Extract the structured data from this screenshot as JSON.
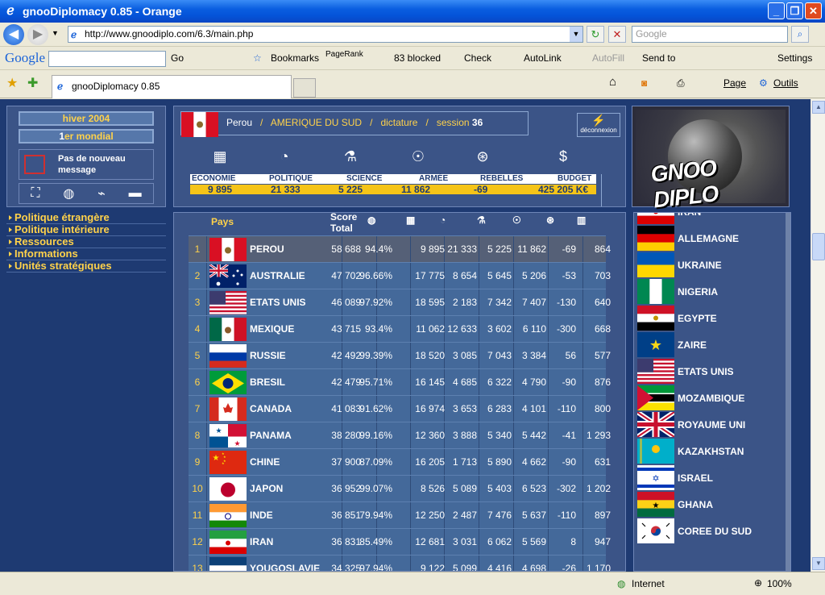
{
  "window": {
    "title": "gnooDiplomacy 0.85 - Orange"
  },
  "nav": {
    "url": "http://www.gnoodiplo.com/6.3/main.php",
    "search_placeholder": "Google"
  },
  "google_toolbar": {
    "logo": "Google",
    "go": "Go",
    "bookmarks": "Bookmarks",
    "pagerank": "PageRank",
    "blocked": "83 blocked",
    "check": "Check",
    "autolink": "AutoLink",
    "autofill": "AutoFill",
    "sendto": "Send to",
    "settings": "Settings"
  },
  "tabs": {
    "active": "gnooDiplomacy 0.85",
    "page": "Page",
    "outils": "Outils"
  },
  "left": {
    "season": "hiver 2004",
    "rank_num": "1",
    "rank_suffix": "er mondial",
    "message": "Pas de nouveau message"
  },
  "menu": [
    "Politique étrangère",
    "Politique intérieure",
    "Ressources",
    "Informations",
    "Unités stratégiques"
  ],
  "country": {
    "name": "Perou",
    "sep": "/",
    "continent": "AMERIQUE DU SUD",
    "regime": "dictature",
    "session_label": "session",
    "session": "36"
  },
  "deconnexion": "déconnexion",
  "stats": {
    "labels": [
      "ECONOMIE",
      "POLITIQUE",
      "SCIENCE",
      "ARMÉE",
      "REBELLES",
      "BUDGET"
    ],
    "values": [
      "9 895",
      "21 333",
      "5 225",
      "11 862",
      "-69",
      "425 205 K€"
    ]
  },
  "ranking": {
    "header": {
      "pays": "Pays",
      "score": "Score",
      "total": "Total"
    },
    "rows": [
      {
        "rank": "1",
        "flag": "peru",
        "name": "PEROU",
        "score": "58 688",
        "pct": "94.4%",
        "eco": "9 895",
        "pol": "21 333",
        "sci": "5 225",
        "arm": "11 862",
        "reb": "-69",
        "ind": "864"
      },
      {
        "rank": "2",
        "flag": "australia",
        "name": "AUSTRALIE",
        "score": "47 702",
        "pct": "96.66%",
        "eco": "17 775",
        "pol": "8 654",
        "sci": "5 645",
        "arm": "5 206",
        "reb": "-53",
        "ind": "703"
      },
      {
        "rank": "3",
        "flag": "usa",
        "name": "ETATS UNIS",
        "score": "46 089",
        "pct": "97.92%",
        "eco": "18 595",
        "pol": "2 183",
        "sci": "7 342",
        "arm": "7 407",
        "reb": "-130",
        "ind": "640"
      },
      {
        "rank": "4",
        "flag": "mexico",
        "name": "MEXIQUE",
        "score": "43 715",
        "pct": "93.4%",
        "eco": "11 062",
        "pol": "12 633",
        "sci": "3 602",
        "arm": "6 110",
        "reb": "-300",
        "ind": "668"
      },
      {
        "rank": "5",
        "flag": "russia",
        "name": "RUSSIE",
        "score": "42 492",
        "pct": "99.39%",
        "eco": "18 520",
        "pol": "3 085",
        "sci": "7 043",
        "arm": "3 384",
        "reb": "56",
        "ind": "577"
      },
      {
        "rank": "6",
        "flag": "brazil",
        "name": "BRESIL",
        "score": "42 479",
        "pct": "95.71%",
        "eco": "16 145",
        "pol": "4 685",
        "sci": "6 322",
        "arm": "4 790",
        "reb": "-90",
        "ind": "876"
      },
      {
        "rank": "7",
        "flag": "canada",
        "name": "CANADA",
        "score": "41 083",
        "pct": "91.62%",
        "eco": "16 974",
        "pol": "3 653",
        "sci": "6 283",
        "arm": "4 101",
        "reb": "-110",
        "ind": "800"
      },
      {
        "rank": "8",
        "flag": "panama",
        "name": "PANAMA",
        "score": "38 280",
        "pct": "99.16%",
        "eco": "12 360",
        "pol": "3 888",
        "sci": "5 340",
        "arm": "5 442",
        "reb": "-41",
        "ind": "1 293"
      },
      {
        "rank": "9",
        "flag": "china",
        "name": "CHINE",
        "score": "37 900",
        "pct": "87.09%",
        "eco": "16 205",
        "pol": "1 713",
        "sci": "5 890",
        "arm": "4 662",
        "reb": "-90",
        "ind": "631"
      },
      {
        "rank": "10",
        "flag": "japan",
        "name": "JAPON",
        "score": "36 952",
        "pct": "99.07%",
        "eco": "8 526",
        "pol": "5 089",
        "sci": "5 403",
        "arm": "6 523",
        "reb": "-302",
        "ind": "1 202"
      },
      {
        "rank": "11",
        "flag": "india",
        "name": "INDE",
        "score": "36 851",
        "pct": "79.94%",
        "eco": "12 250",
        "pol": "2 487",
        "sci": "7 476",
        "arm": "5 637",
        "reb": "-110",
        "ind": "897"
      },
      {
        "rank": "12",
        "flag": "iran",
        "name": "IRAN",
        "score": "36 831",
        "pct": "85.49%",
        "eco": "12 681",
        "pol": "3 031",
        "sci": "6 062",
        "arm": "5 569",
        "reb": "8",
        "ind": "947"
      },
      {
        "rank": "13",
        "flag": "yugoslavia",
        "name": "YOUGOSLAVIE",
        "score": "34 325",
        "pct": "97.94%",
        "eco": "9 122",
        "pol": "5 099",
        "sci": "4 416",
        "arm": "4 698",
        "reb": "-26",
        "ind": "1 170"
      }
    ]
  },
  "countries_list": [
    {
      "flag": "iran",
      "name": "IRAN"
    },
    {
      "flag": "germany",
      "name": "ALLEMAGNE"
    },
    {
      "flag": "ukraine",
      "name": "UKRAINE"
    },
    {
      "flag": "nigeria",
      "name": "NIGERIA"
    },
    {
      "flag": "egypt",
      "name": "EGYPTE"
    },
    {
      "flag": "zaire",
      "name": "ZAIRE"
    },
    {
      "flag": "usa",
      "name": "ETATS UNIS"
    },
    {
      "flag": "mozambique",
      "name": "MOZAMBIQUE"
    },
    {
      "flag": "uk",
      "name": "ROYAUME UNI"
    },
    {
      "flag": "kazakhstan",
      "name": "KAZAKHSTAN"
    },
    {
      "flag": "israel",
      "name": "ISRAEL"
    },
    {
      "flag": "ghana",
      "name": "GHANA"
    },
    {
      "flag": "korea",
      "name": "COREE DU SUD"
    }
  ],
  "status": {
    "zone": "Internet",
    "zoom": "100%"
  },
  "colors": {
    "accent": "#ffd24a",
    "page_bg": "#1e3a72",
    "panel": "#3b5487",
    "row": "#44699a"
  }
}
